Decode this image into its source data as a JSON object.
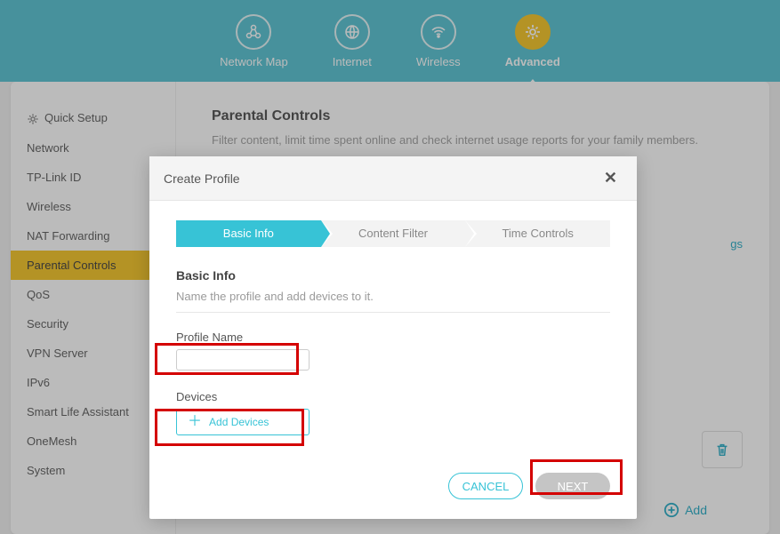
{
  "header": {
    "navs": [
      "Network Map",
      "Internet",
      "Wireless",
      "Advanced"
    ]
  },
  "sidebar": {
    "items": [
      "Quick Setup",
      "Network",
      "TP-Link ID",
      "Wireless",
      "NAT Forwarding",
      "Parental Controls",
      "QoS",
      "Security",
      "VPN Server",
      "IPv6",
      "Smart Life Assistant",
      "OneMesh",
      "System"
    ]
  },
  "page": {
    "title": "Parental Controls",
    "desc": "Filter content, limit time spent online and check internet usage reports for your family members.",
    "link_fragment": "gs",
    "add_label": "Add"
  },
  "modal": {
    "title": "Create Profile",
    "steps": [
      "Basic Info",
      "Content Filter",
      "Time Controls"
    ],
    "section_title": "Basic Info",
    "section_desc": "Name the profile and add devices to it.",
    "profile_name_label": "Profile Name",
    "profile_name_value": "",
    "devices_label": "Devices",
    "add_devices_label": "Add Devices",
    "cancel": "CANCEL",
    "next": "NEXT"
  }
}
